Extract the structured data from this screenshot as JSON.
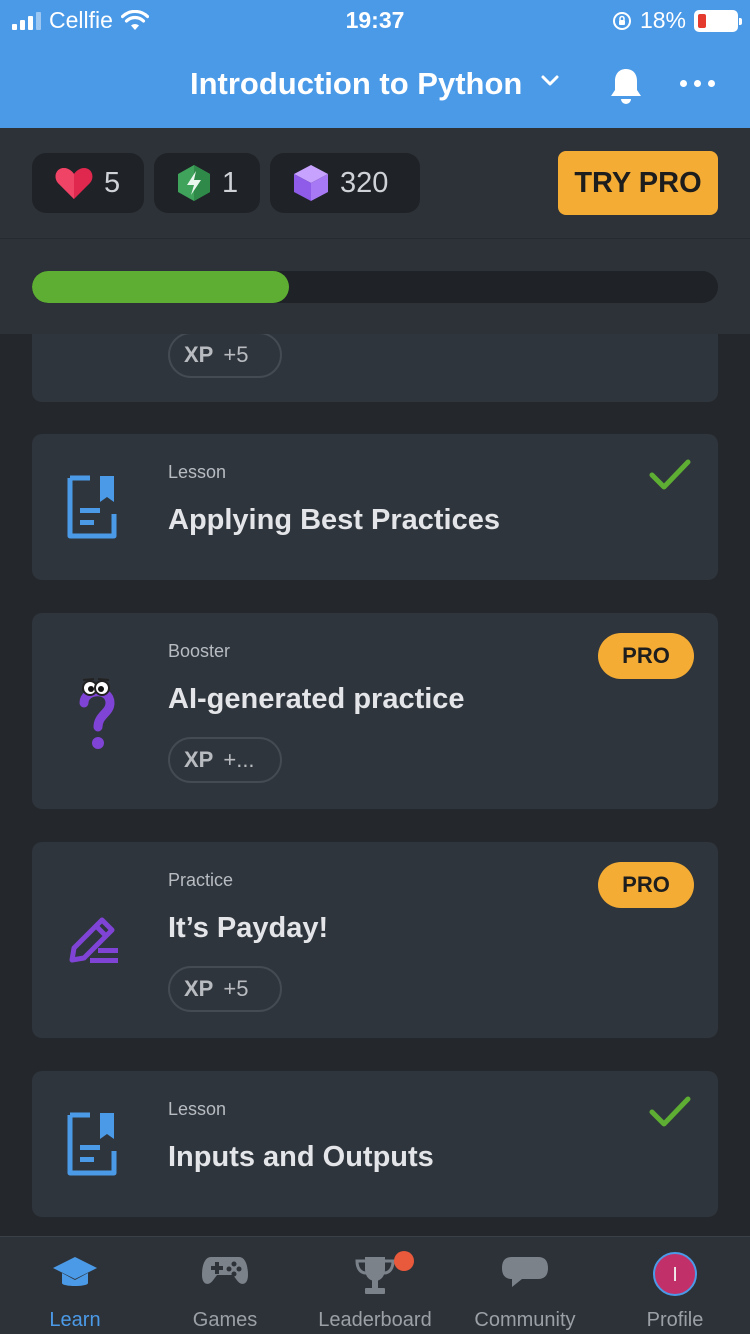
{
  "status_bar": {
    "carrier": "Cellfie",
    "time": "19:37",
    "battery": "18%"
  },
  "header": {
    "title": "Introduction to Python"
  },
  "stats": {
    "hearts": "5",
    "streak": "1",
    "gems": "320",
    "try_pro_label": "TRY PRO"
  },
  "progress": {
    "fraction": 0.375
  },
  "list": {
    "partial_card": {
      "xp_label": "XP",
      "xp_value": "+5"
    },
    "cards": [
      {
        "type": "Lesson",
        "title": "Applying Best Practices",
        "completed": true
      },
      {
        "type": "Booster",
        "title": "AI-generated practice",
        "badge": "PRO",
        "xp_label": "XP",
        "xp_value": "+..."
      },
      {
        "type": "Practice",
        "title": "It’s Payday!",
        "badge": "PRO",
        "xp_label": "XP",
        "xp_value": "+5"
      },
      {
        "type": "Lesson",
        "title": "Inputs and Outputs",
        "completed": true
      }
    ]
  },
  "nav": {
    "items": [
      {
        "label": "Learn",
        "icon": "graduation-cap-icon",
        "active": true
      },
      {
        "label": "Games",
        "icon": "gamepad-icon"
      },
      {
        "label": "Leaderboard",
        "icon": "trophy-icon"
      },
      {
        "label": "Community",
        "icon": "chat-bubble-icon"
      },
      {
        "label": "Profile",
        "icon": "avatar-icon",
        "avatar_initial": "I"
      }
    ]
  },
  "colors": {
    "header": "#4b9ae8",
    "accent": "#f4ac34",
    "progress": "#5dae33",
    "check": "#5dae33"
  }
}
